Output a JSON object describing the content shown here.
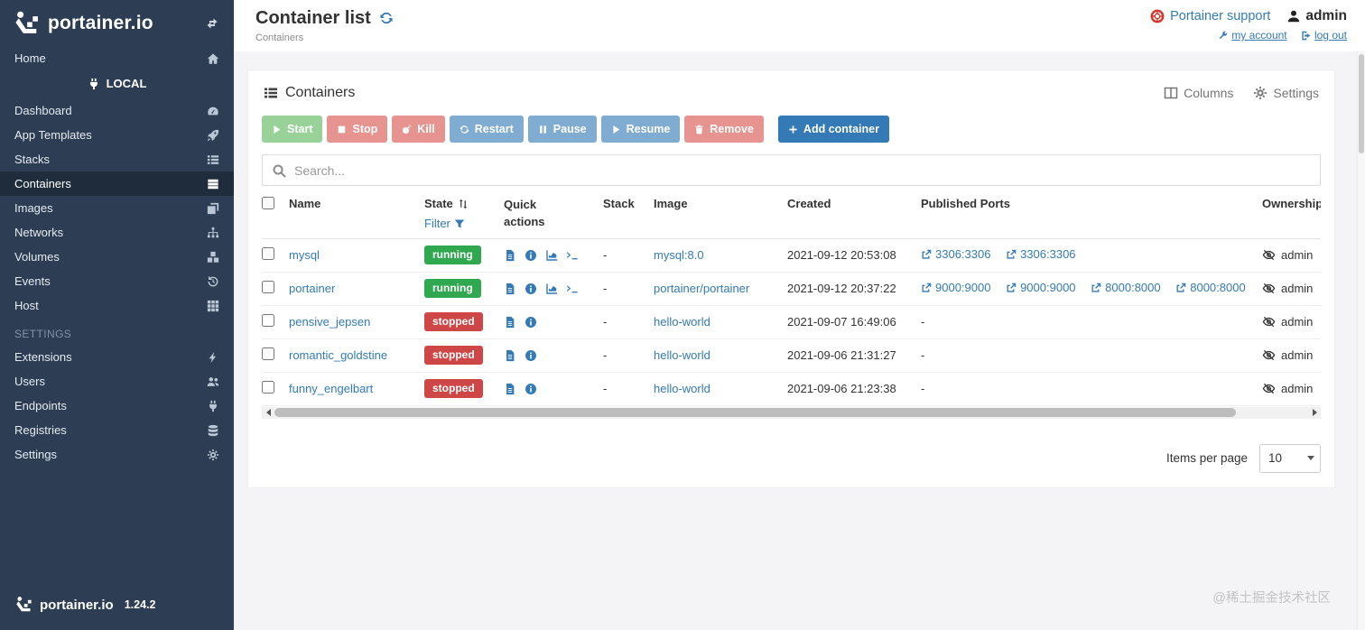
{
  "sidebar": {
    "brand": "portainer.io",
    "home": "Home",
    "endpoint": "LOCAL",
    "menu": [
      {
        "label": "Dashboard"
      },
      {
        "label": "App Templates"
      },
      {
        "label": "Stacks"
      },
      {
        "label": "Containers"
      },
      {
        "label": "Images"
      },
      {
        "label": "Networks"
      },
      {
        "label": "Volumes"
      },
      {
        "label": "Events"
      },
      {
        "label": "Host"
      }
    ],
    "settings_header": "SETTINGS",
    "settings_menu": [
      {
        "label": "Extensions"
      },
      {
        "label": "Users"
      },
      {
        "label": "Endpoints"
      },
      {
        "label": "Registries"
      },
      {
        "label": "Settings"
      }
    ],
    "footer_brand": "portainer.io",
    "version": "1.24.2"
  },
  "header": {
    "title": "Container list",
    "breadcrumb": "Containers",
    "support": "Portainer support",
    "user": "admin",
    "my_account": "my account",
    "log_out": "log out"
  },
  "panel": {
    "title": "Containers",
    "columns_label": "Columns",
    "settings_label": "Settings",
    "search_placeholder": "Search...",
    "buttons": {
      "start": "Start",
      "stop": "Stop",
      "kill": "Kill",
      "restart": "Restart",
      "pause": "Pause",
      "resume": "Resume",
      "remove": "Remove",
      "add": "Add container"
    }
  },
  "table": {
    "headers": {
      "name": "Name",
      "state": "State",
      "filter": "Filter",
      "quick_actions": "Quick actions",
      "stack": "Stack",
      "image": "Image",
      "created": "Created",
      "ports": "Published Ports",
      "ownership": "Ownership"
    },
    "rows": [
      {
        "name": "mysql",
        "state": "running",
        "stack": "-",
        "image": "mysql:8.0",
        "created": "2021-09-12 20:53:08",
        "ports": [
          "3306:3306",
          "3306:3306"
        ],
        "ownership": "admin"
      },
      {
        "name": "portainer",
        "state": "running",
        "stack": "-",
        "image": "portainer/portainer",
        "created": "2021-09-12 20:37:22",
        "ports": [
          "9000:9000",
          "9000:9000",
          "8000:8000",
          "8000:8000"
        ],
        "ownership": "admin"
      },
      {
        "name": "pensive_jepsen",
        "state": "stopped",
        "stack": "-",
        "image": "hello-world",
        "created": "2021-09-07 16:49:06",
        "ports_none": "-",
        "ownership": "admin"
      },
      {
        "name": "romantic_goldstine",
        "state": "stopped",
        "stack": "-",
        "image": "hello-world",
        "created": "2021-09-06 21:31:27",
        "ports_none": "-",
        "ownership": "admin"
      },
      {
        "name": "funny_engelbart",
        "state": "stopped",
        "stack": "-",
        "image": "hello-world",
        "created": "2021-09-06 21:23:38",
        "ports_none": "-",
        "ownership": "admin"
      }
    ]
  },
  "pagination": {
    "label": "Items per page",
    "value": "10"
  },
  "watermark": "@稀土掘金技术社区",
  "colors": {
    "primary": "#337ab7",
    "sidebar_bg": "#2d3e54",
    "sidebar_active_bg": "#1e2c3c",
    "running_badge": "#2fa84f",
    "stopped_badge": "#cf4647",
    "support_icon": "#d9342b",
    "success_btn": "#5cb85c",
    "danger_btn": "#d9534f"
  },
  "icons": {
    "portainer-logo": "porter-with-boxes",
    "collapse-icon": "double-arrows",
    "refresh-icon": "circular-arrows",
    "support-icon": "life-ring",
    "search-icon": "magnifier",
    "sort-icon": "up-down-arrows",
    "filter-icon": "funnel",
    "logs-icon": "file-text",
    "inspect-icon": "info-circle",
    "stats-icon": "area-chart",
    "console-icon": "terminal",
    "port-icon": "external-link",
    "ownership-icon": "eye-slash"
  }
}
